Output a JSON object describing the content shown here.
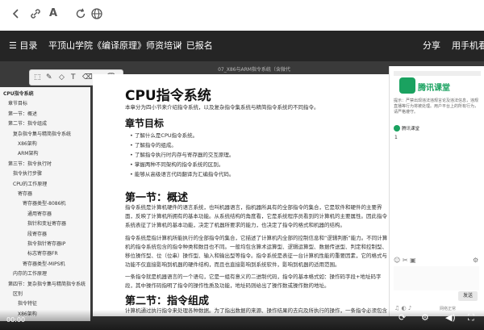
{
  "topbar": {
    "back_icon": "chevron-left-icon",
    "link_icon": "link-icon",
    "font_icon": "font-size-icon",
    "refresh_icon": "refresh-icon",
    "globe_icon": "globe-icon"
  },
  "course": {
    "menu_label": "目录",
    "title": "平顶山学院《编译原理》师资培训",
    "enrolled_label": "已报名",
    "share_label": "分享",
    "app_label": "用手机看"
  },
  "pdf": {
    "title_text": "07_X86与ARM指令系统（含微代"
  },
  "sidebar": {
    "items": [
      "CPU指令系统",
      "章节目标",
      "第一节：概述",
      "第二节：指令组成",
      "复杂指令集与精简指令系统",
      "X86架构",
      "ARM架构",
      "第三节：指令执行时",
      "指令执行步骤",
      "CPU的工作原理",
      "寄存器",
      "寄存器类型-8086机",
      "通用寄存器",
      "指针和变址寄存器",
      "段寄存器",
      "指令指针寄存器IP",
      "标志寄存器FR",
      "寄存器类型-MIPS机",
      "内存的工作原理",
      "第四节：复杂指令集与精简指令系统",
      "区别",
      "指令特征",
      "X86架构"
    ]
  },
  "doc": {
    "title": "CPU指令系统",
    "intro": "本章分为四小节来介绍指令系统，以及复杂指令集系统与精简指令系统的不同指令。",
    "section_goal": "章节目标",
    "bullets": [
      "了解什么是CPU指令系统。",
      "了解指令的组成。",
      "了解指令执行时内存与寄存器的交互原理。",
      "掌握两种不同架构的指令系统的区别。",
      "能够从高级语言代码翻译为汇编指令代码。"
    ],
    "section1": "第一节：概述",
    "para1": "指令系统是计算机硬件的语言系统，也叫机器语言，指机器所具有的全部指令的集合，它是软件和硬件的主要界面，反映了计算机所拥有的基本功能。从系统结构的角度看，它是系统程序员看到的计算机的主要属性。因此指令系统表征了计算机的基本功能，决定了机器所要求的能力，也决定了指令的格式和机器的结构。",
    "para2": "指令系统是指计算机所能执行的全部指令的集合，它描述了计算机内全部的控制信息和“逻辑判断”能力。不同计算机的指令系统包含的指令种类和数目也不同。一般均包含算术运算型、逻辑运算型、数据传送型、判定和控制型、移位操作型、位（位串）操作型、输入和输出型等指令。指令系统是表征一台计算机性能的重要因素，它的格式与功能不仅直接影响到机器的硬件结构，而且也直接影响到系统软件，影响到机器的适用范围。",
    "para3": "一条指令就是机器语言的一个语句，它是一组有意义的二进制代码，指令的基本格式如：操作码字段+地址码字段，其中操作码指明了指令的操作性质及功能，地址码则给出了操作数或操作数的地址。",
    "section2": "第二节：指令组成",
    "para4": "计算机通过执行指令来处理各种数据。为了指出数据的来源、操作结果的去向及所执行的操作，一条指令必须包含下列信息："
  },
  "chat": {
    "logo_text": "腾讯课堂",
    "notice": "提示：严禁出现违法违规言论及违法信息，违规直播等行为将被处理。用户平台上的所有行为，请严格遵守。",
    "user_name": "腾讯课堂",
    "message": "1",
    "send_label": "发送",
    "bottom_hint": "网络正常"
  },
  "player": {
    "current_time": "00:00",
    "volume_icon": "volume-icon",
    "fullscreen_icon": "fullscreen-icon",
    "refresh_icon": "reload-icon",
    "settings_icon": "settings-icon"
  },
  "colors": {
    "course_bar_bg": "#252525",
    "video_bg": "#3a3a3a",
    "accent": "#1aa260"
  }
}
